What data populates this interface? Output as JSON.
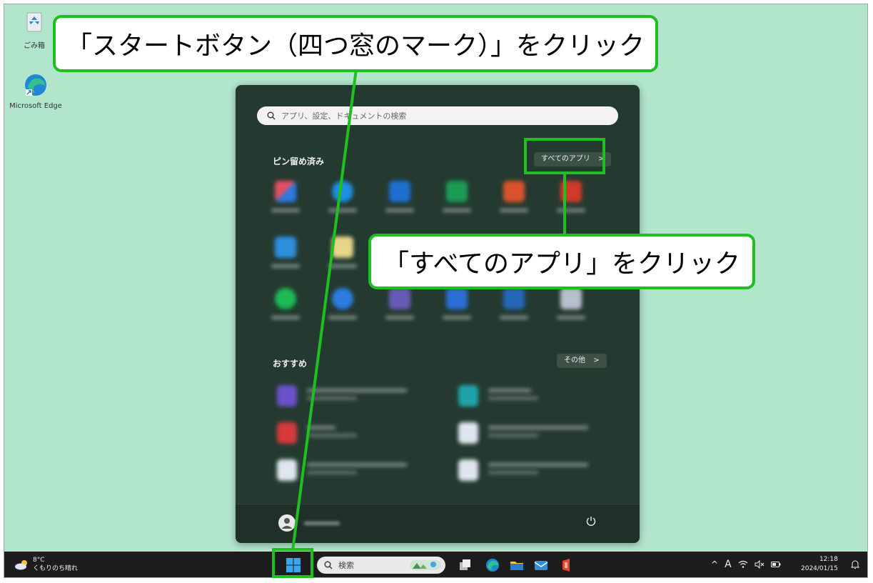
{
  "desktop": {
    "recycle_bin_label": "ごみ箱",
    "edge_label": "Microsoft Edge"
  },
  "start_menu": {
    "search_placeholder": "アプリ、設定、ドキュメントの検索",
    "pinned_title": "ピン留め済み",
    "all_apps_button": "すべてのアプリ",
    "recommended_title": "おすすめ",
    "more_button": "その他",
    "all_apps_chevron": ">",
    "more_chevron": ">"
  },
  "taskbar": {
    "weather_temp": "8°C",
    "weather_desc": "くもりのち晴れ",
    "search_label": "検索",
    "tray_chevron": "^",
    "ime_label": "A",
    "time": "12:18",
    "date": "2024/01/15"
  },
  "annotations": {
    "callout_start": "「スタートボタン（四つ窓のマーク）」をクリック",
    "callout_all_apps": "「すべてのアプリ」をクリック",
    "highlight_color": "#1fbf1f"
  },
  "colors": {
    "desktop_bg": "#b1e5cc",
    "start_menu_bg": "#243a30",
    "taskbar_bg": "#1d1d1d"
  }
}
